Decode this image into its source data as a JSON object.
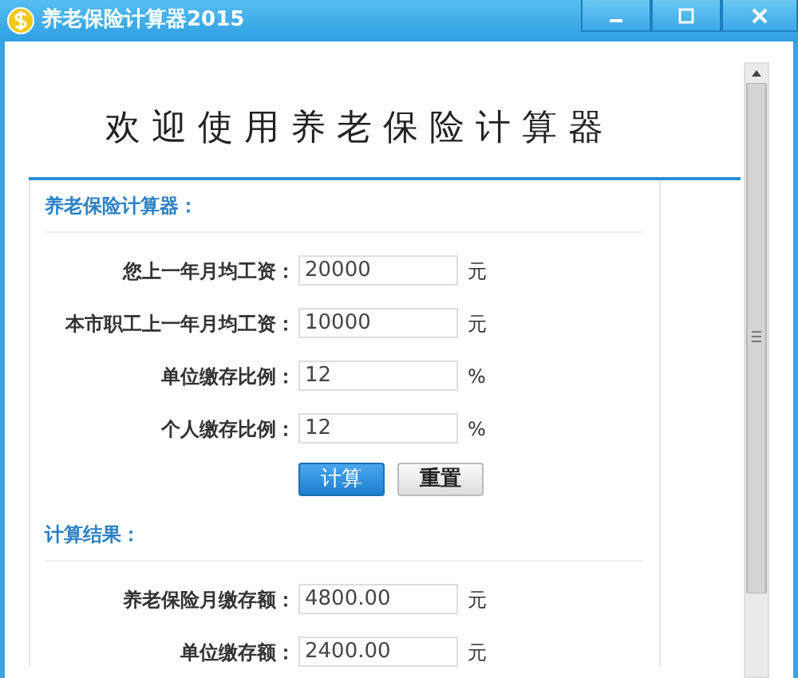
{
  "window": {
    "title": "养老保险计算器2015"
  },
  "banner": "欢迎使用养老保险计算器",
  "sections": [
    {
      "heading": "养老保险计算器：",
      "fields": [
        {
          "label": "您上一年月均工资：",
          "value": "20000",
          "unit": "元"
        },
        {
          "label": "本市职工上一年月均工资：",
          "value": "10000",
          "unit": "元"
        },
        {
          "label": "单位缴存比例：",
          "value": "12",
          "unit": "%"
        },
        {
          "label": "个人缴存比例：",
          "value": "12",
          "unit": "%"
        }
      ],
      "buttons": [
        {
          "label": "计算",
          "kind": "primary"
        },
        {
          "label": "重置",
          "kind": "secondary"
        }
      ]
    },
    {
      "heading": "计算结果：",
      "fields": [
        {
          "label": "养老保险月缴存额：",
          "value": "4800.00",
          "unit": "元"
        },
        {
          "label": "单位缴存额：",
          "value": "2400.00",
          "unit": "元"
        }
      ]
    }
  ]
}
